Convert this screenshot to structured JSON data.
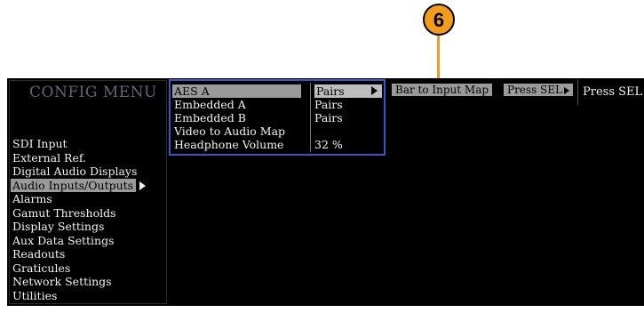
{
  "callout": {
    "number": "6"
  },
  "menu": {
    "title": "CONFIG MENU",
    "items": [
      {
        "label": "SDI Input"
      },
      {
        "label": "External Ref."
      },
      {
        "label": "Digital Audio Displays"
      },
      {
        "label": "Audio Inputs/Outputs"
      },
      {
        "label": "Alarms"
      },
      {
        "label": "Gamut Thresholds"
      },
      {
        "label": "Display Settings"
      },
      {
        "label": "Aux Data Settings"
      },
      {
        "label": "Readouts"
      },
      {
        "label": "Graticules"
      },
      {
        "label": "Network Settings"
      },
      {
        "label": "Utilities"
      }
    ],
    "selected_index": 3
  },
  "submenu": {
    "rows": [
      {
        "label": "AES A",
        "value": "Pairs"
      },
      {
        "label": "Embedded A",
        "value": "Pairs"
      },
      {
        "label": "Embedded B",
        "value": "Pairs"
      },
      {
        "label": "Video to Audio Map",
        "value": ""
      },
      {
        "label": "Headphone Volume",
        "value": "32 %"
      }
    ]
  },
  "buttons": {
    "bar_to_input_map": "Bar to Input Map",
    "press_sel_1": "Press SEL",
    "press_sel_2": "Press SEL"
  },
  "colors": {
    "callout": "#f39c1c",
    "submenu_border": "#3a55c8",
    "highlight": "#9a9a9a"
  }
}
